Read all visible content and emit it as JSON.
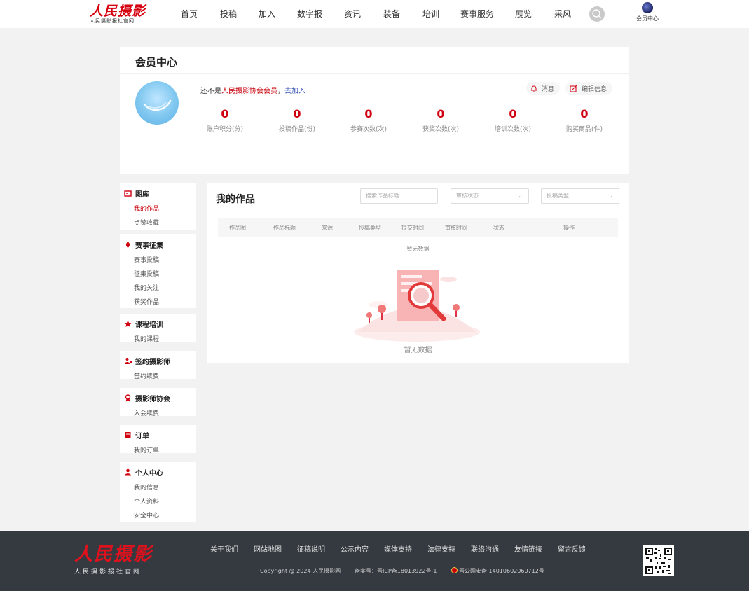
{
  "header": {
    "logo_text": "人民摄影",
    "logo_sub": "人民摄影报社官网",
    "nav": [
      {
        "label": "首页",
        "w": 44
      },
      {
        "label": "投稿",
        "w": 68
      },
      {
        "label": "加入",
        "w": 42
      },
      {
        "label": "数字报",
        "w": 80
      },
      {
        "label": "资讯",
        "w": 42
      },
      {
        "label": "装备",
        "w": 70
      },
      {
        "label": "培训",
        "w": 42
      },
      {
        "label": "赛事服务",
        "w": 90
      },
      {
        "label": "展览",
        "w": 42
      },
      {
        "label": "采风",
        "w": 70
      }
    ],
    "member_label": "会员中心"
  },
  "member": {
    "title": "会员中心",
    "notice_prefix": "还不是",
    "notice_org": "人民摄影协会会员",
    "notice_sep": "，",
    "notice_join": "去加入",
    "message_label": "消息",
    "edit_label": "编辑信息",
    "stats": [
      {
        "value": "0",
        "label": "账户积分(分)"
      },
      {
        "value": "0",
        "label": "投稿作品(份)"
      },
      {
        "value": "0",
        "label": "参赛次数(次)"
      },
      {
        "value": "0",
        "label": "获奖次数(次)"
      },
      {
        "value": "0",
        "label": "培训次数(次)"
      },
      {
        "value": "0",
        "label": "购买商品(件)"
      }
    ]
  },
  "sidebar": {
    "groups": [
      {
        "title": "图库",
        "items": [
          "我的作品",
          "点赞收藏"
        ]
      },
      {
        "title": "赛事征集",
        "items": [
          "赛事投稿",
          "征集投稿",
          "我的关注",
          "获奖作品"
        ]
      },
      {
        "title": "课程培训",
        "items": [
          "我的课程"
        ]
      },
      {
        "title": "签约摄影师",
        "items": [
          "签约续费"
        ]
      },
      {
        "title": "摄影师协会",
        "items": [
          "入会续费"
        ]
      },
      {
        "title": "订单",
        "items": [
          "我的订单"
        ]
      },
      {
        "title": "个人中心",
        "items": [
          "我的信息",
          "个人资料",
          "安全中心"
        ]
      }
    ]
  },
  "works": {
    "title": "我的作品",
    "search_placeholder": "搜索作品标题",
    "review_select": "审核状态",
    "type_select": "投稿类型",
    "columns": [
      "作品图",
      "作品标题",
      "来源",
      "投稿类型",
      "提交时间",
      "审核时间",
      "状态",
      "操作"
    ],
    "no_data_row": "暂无数据",
    "empty_text": "暂无数据"
  },
  "footer": {
    "logo_text": "人民摄影",
    "logo_sub": "人民摄影报社官网",
    "links": [
      "关于我们",
      "网站地图",
      "征稿说明",
      "公示内容",
      "媒体支持",
      "法律支持",
      "联络沟通",
      "友情链接",
      "留言反馈"
    ],
    "copyright": "Copyright @ 2024 人民摄影网",
    "icp": "备案号：晋ICP备18013922号-1",
    "police": "晋公网安备 14010602060712号"
  },
  "colors": {
    "accent": "#c7000b",
    "footer_bg": "#343a40"
  }
}
